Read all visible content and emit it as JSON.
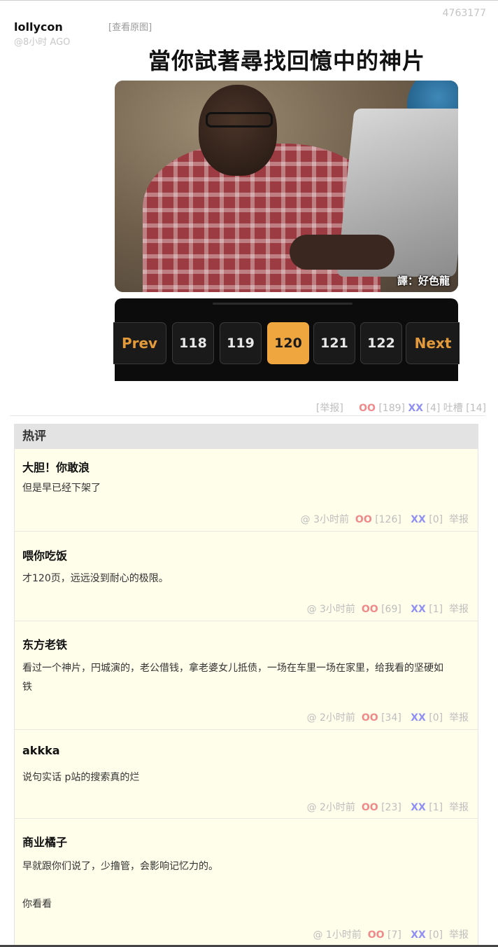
{
  "post": {
    "id": "4763177",
    "author": "lollycon",
    "time": "@8小时 AGO",
    "view_original": "[查看原图]",
    "meme_caption": "當你試著尋找回憶中的神片",
    "watermark": "譯：好色龍",
    "pager": {
      "prev": "Prev",
      "pages": [
        "118",
        "119",
        "120",
        "121",
        "122"
      ],
      "current": "120",
      "next": "Next"
    },
    "actions": {
      "report": "[举报]",
      "oo_label": "OO",
      "oo_count": "[189]",
      "xx_label": "XX",
      "xx_count": "[4]",
      "tucao_label": "吐槽",
      "tucao_count": "[14]"
    }
  },
  "hot": {
    "title": "热评",
    "comments": [
      {
        "author": "大胆！你敢浪",
        "lines": [
          "但是早已经下架了"
        ],
        "time": "@  3小时前",
        "oo": "OO",
        "oo_count": "[126]",
        "xx": "XX",
        "xx_count": "[0]",
        "report": "举报"
      },
      {
        "author": "喂你吃饭",
        "lines": [
          "才120页，远远没到耐心的极限。"
        ],
        "time": "@  3小时前",
        "oo": "OO",
        "oo_count": "[69]",
        "xx": "XX",
        "xx_count": "[1]",
        "report": "举报"
      },
      {
        "author": "东方老铁",
        "lines": [
          "看过一个神片，円城演的，老公借钱，拿老婆女儿抵债，一场在车里一场在家里，给我看的坚硬如",
          "铁"
        ],
        "time": "@  2小时前",
        "oo": "OO",
        "oo_count": "[34]",
        "xx": "XX",
        "xx_count": "[0]",
        "report": "举报"
      },
      {
        "author": "akkka",
        "lines": [
          "说句实话 p站的搜索真的烂"
        ],
        "time": "@  2小时前",
        "oo": "OO",
        "oo_count": "[23]",
        "xx": "XX",
        "xx_count": "[1]",
        "report": "举报"
      },
      {
        "author": "商业橘子",
        "lines": [
          "早就跟你们说了，少撸管，会影响记忆力的。",
          "你看看"
        ],
        "time": "@  1小时前",
        "oo": "OO",
        "oo_count": "[7]",
        "xx": "XX",
        "xx_count": "[0]",
        "report": "举报"
      }
    ]
  },
  "colors": {
    "oo": "#f08a8a",
    "xx": "#8f8ff5",
    "pager_current": "#f0a63f",
    "hot_background": "#fefeeb"
  }
}
